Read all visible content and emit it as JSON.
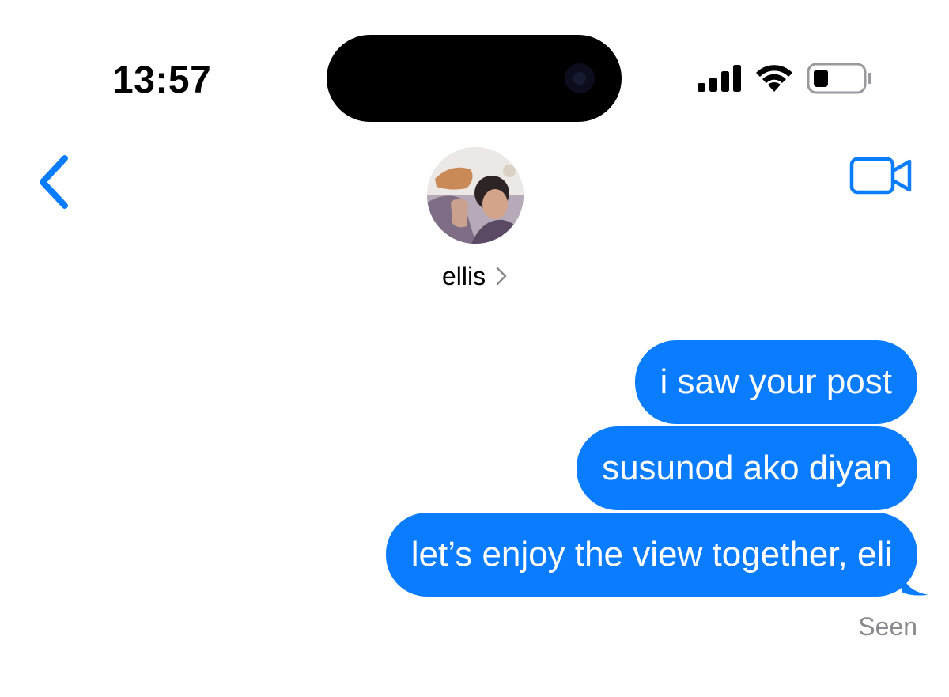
{
  "status_bar": {
    "time": "13:57",
    "icons": [
      "signal-bars-icon",
      "wifi-icon",
      "battery-low-icon"
    ]
  },
  "header": {
    "back_icon": "chevron-left-icon",
    "contact_name": "ellis",
    "contact_chevron_icon": "chevron-right-icon",
    "video_call_icon": "video-camera-icon"
  },
  "messages": [
    {
      "text": "i saw your post",
      "sender": "me"
    },
    {
      "text": "susunod ako diyan",
      "sender": "me"
    },
    {
      "text": "let’s enjoy the view together, eli",
      "sender": "me"
    }
  ],
  "receipt": "Seen",
  "colors": {
    "accent": "#0a7cff",
    "bubble_text": "#ffffff",
    "receipt_text": "#8a8a8e"
  }
}
